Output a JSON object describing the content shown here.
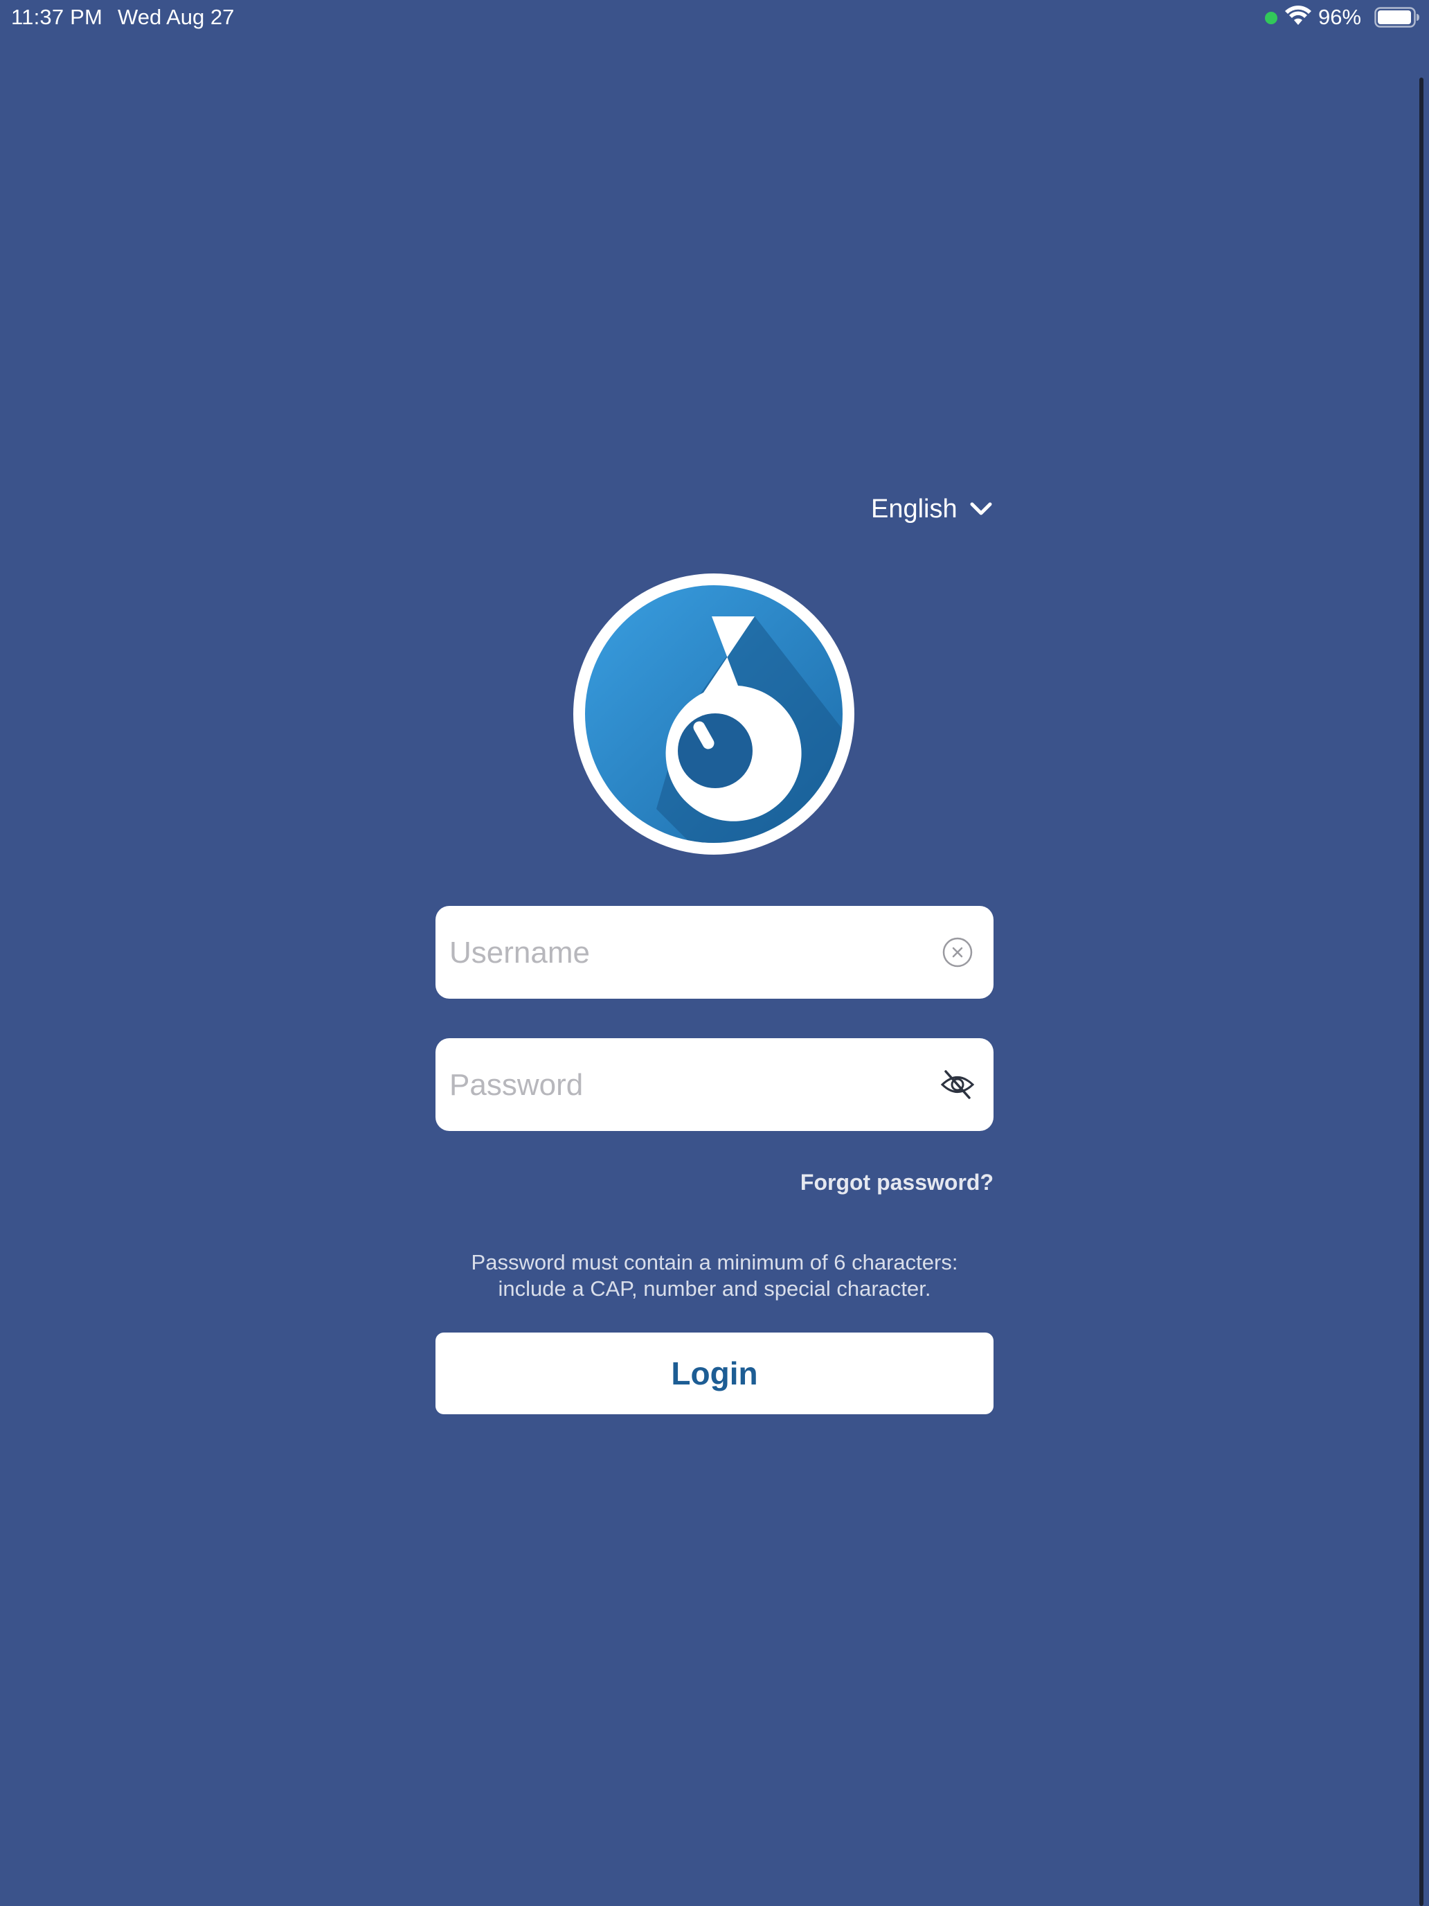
{
  "status_bar": {
    "time": "11:37 PM",
    "date": "Wed Aug 27",
    "battery_percent": "96%",
    "battery_level": 0.96,
    "recording_dot_color": "#32c85a"
  },
  "language": {
    "selected": "English",
    "icon": "chevron-down-icon"
  },
  "logo": {
    "icon": "app-logo-six",
    "colors": {
      "outer": "#ffffff",
      "inner": "#2f8ed1",
      "shadow": "#1b5f95"
    }
  },
  "username": {
    "placeholder": "Username",
    "value": "",
    "icon": "clear-icon"
  },
  "password": {
    "placeholder": "Password",
    "value": "",
    "icon": "eye-hidden-icon"
  },
  "forgot_password": "Forgot password?",
  "hint": {
    "line1": "Password must contain a minimum of 6 characters:",
    "line2": "include a CAP, number and special character."
  },
  "login_label": "Login",
  "colors": {
    "background": "#3b538b",
    "button_text": "#1d5d94",
    "field_background": "#ffffff"
  }
}
